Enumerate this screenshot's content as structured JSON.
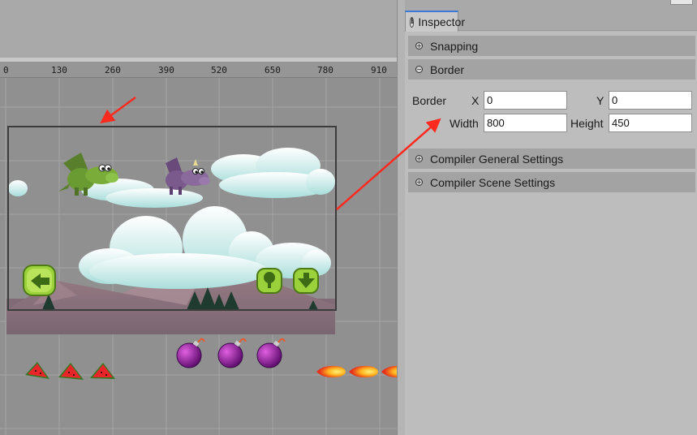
{
  "ruler": {
    "ticks": [
      "0",
      "130",
      "260",
      "390",
      "520",
      "650",
      "780",
      "910"
    ]
  },
  "scene": {
    "icons": {
      "green-dragon": "green-dragon-sprite",
      "purple-dragon": "purple-dragon-sprite",
      "back-button": "back-button-sprite",
      "tree-button": "tree-button-sprite",
      "down-button": "down-button-sprite",
      "watermelon": "watermelon-sprite",
      "bomb": "bomb-sprite",
      "fireball": "fireball-sprite"
    },
    "colors": {
      "annotation_arrow": "#ff2a1f",
      "scene_border": "#3c3c3c",
      "green_button": "#9bd13a"
    }
  },
  "inspector": {
    "tab_title": "Inspector",
    "tab_icon": "info-icon",
    "sections": {
      "snapping": {
        "label": "Snapping",
        "state": "collapsed"
      },
      "border": {
        "label": "Border",
        "state": "expanded"
      },
      "compiler_general": {
        "label": "Compiler General Settings",
        "state": "collapsed"
      },
      "compiler_scene": {
        "label": "Compiler Scene Settings",
        "state": "collapsed"
      }
    },
    "border": {
      "group_label": "Border",
      "x_label": "X",
      "x_value": "0",
      "y_label": "Y",
      "y_value": "0",
      "width_label": "Width",
      "width_value": "800",
      "height_label": "Height",
      "height_value": "450"
    },
    "colors": {
      "tab_accent": "#3b78d8"
    }
  }
}
